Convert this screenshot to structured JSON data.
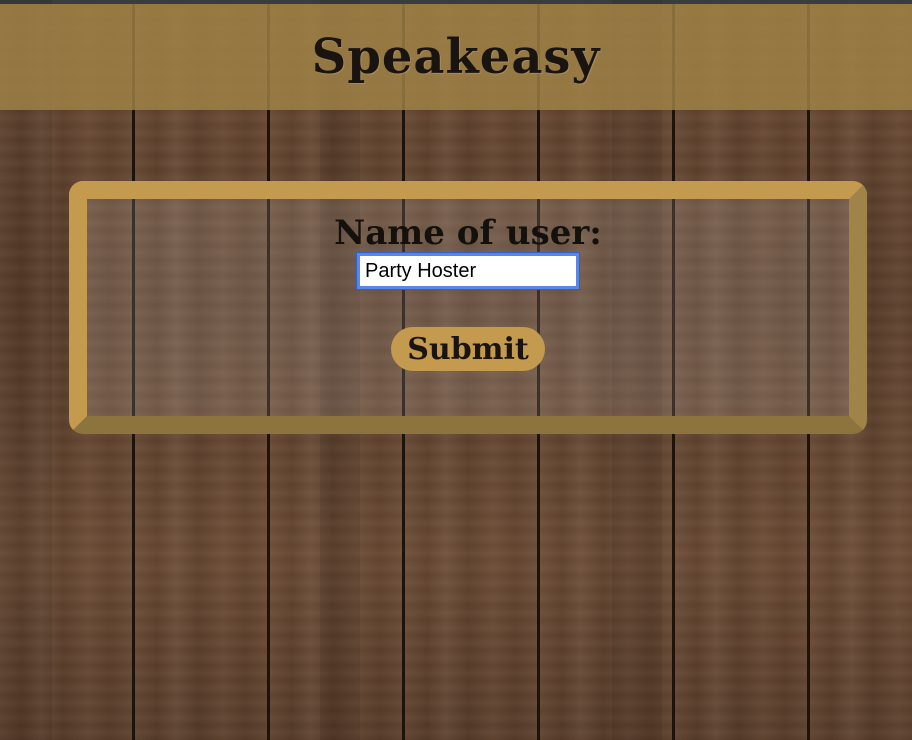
{
  "header": {
    "title": "Speakeasy"
  },
  "form": {
    "label": "Name of user:",
    "input_value": "Party Hoster",
    "submit_label": "Submit"
  },
  "colors": {
    "header_bg": "#a08246",
    "frame": "#c49a4e",
    "button": "#c49a4e",
    "input_focus": "#5b86e6"
  }
}
